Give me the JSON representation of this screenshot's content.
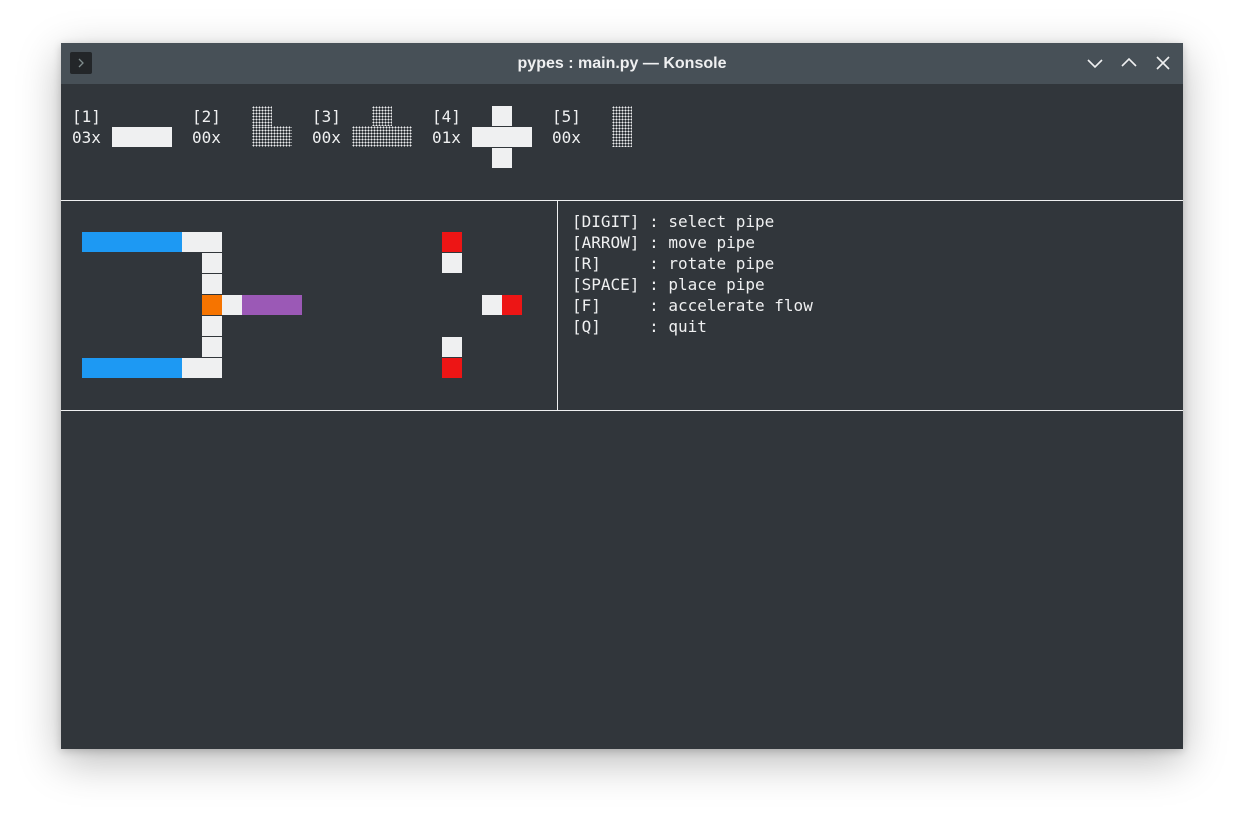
{
  "window": {
    "title": "pypes : main.py — Konsole",
    "icon": "terminal-icon",
    "controls": [
      "minimize-icon",
      "maximize-icon",
      "close-icon"
    ]
  },
  "inventory": [
    {
      "key": "[1]",
      "count": "03x"
    },
    {
      "key": "[2]",
      "count": "00x"
    },
    {
      "key": "[3]",
      "count": "00x"
    },
    {
      "key": "[4]",
      "count": "01x"
    },
    {
      "key": "[5]",
      "count": "00x"
    }
  ],
  "help": [
    "[DIGIT] : select pipe",
    "[ARROW] : move pipe",
    "[R]     : rotate pipe",
    "[SPACE] : place pipe",
    "[F]     : accelerate flow",
    "[Q]     : quit"
  ],
  "colors": {
    "background": "#31363b",
    "titlebar": "#475057",
    "pipe": "#eff0f1",
    "water": "#1d99f3",
    "source": "#f67400",
    "flow": "#9b59b6",
    "drain": "#ed1515"
  }
}
